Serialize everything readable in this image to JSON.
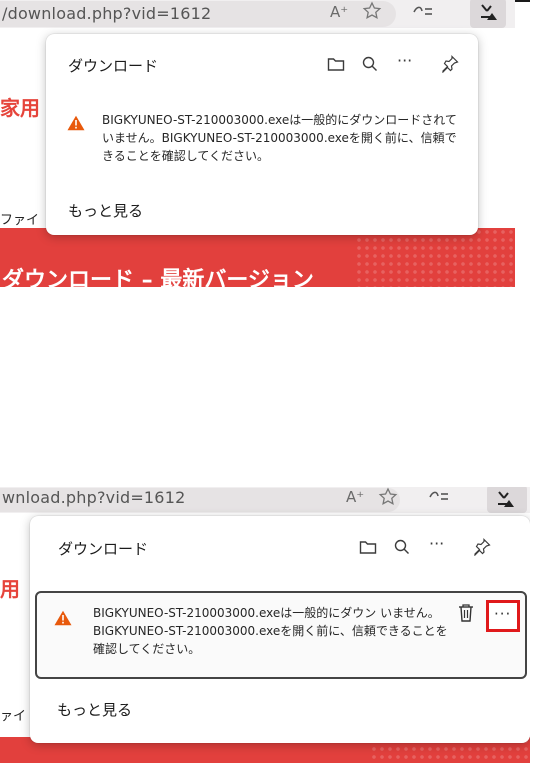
{
  "shot1": {
    "url": "/download.php?vid=1612",
    "page_heading_fragment": "家用",
    "file_label_fragment": "ファイ",
    "banner_text": "ダウンロード – 最新バージョン",
    "panel": {
      "title": "ダウンロード",
      "message": "BIGKYUNEO-ST-210003000.exeは一般的にダウンロードされていません。BIGKYUNEO-ST-210003000.exeを開く前に、信頼できることを確認してください。",
      "more_link": "もっと見る"
    }
  },
  "shot2": {
    "url": "wnload.php?vid=1612",
    "page_heading_fragment": "用",
    "file_label_fragment": "ァイ",
    "panel": {
      "title": "ダウンロード",
      "message": "BIGKYUNEO-ST-210003000.exeは一般的にダウン  いません。BIGKYUNEO-ST-210003000.exeを開く前に、信頼できることを確認してください。",
      "more_link": "もっと見る"
    }
  },
  "toolbar_icons": {
    "read_aloud": "A⁺",
    "favorites": "star-icon",
    "collections": "collections-icon",
    "download": "download-icon"
  },
  "panel_icons": [
    "folder-icon",
    "search-icon",
    "more-icon",
    "pin-icon"
  ],
  "colors": {
    "accent_red": "#e2403d",
    "warning": "#e8590c",
    "highlight": "#e0191b"
  }
}
